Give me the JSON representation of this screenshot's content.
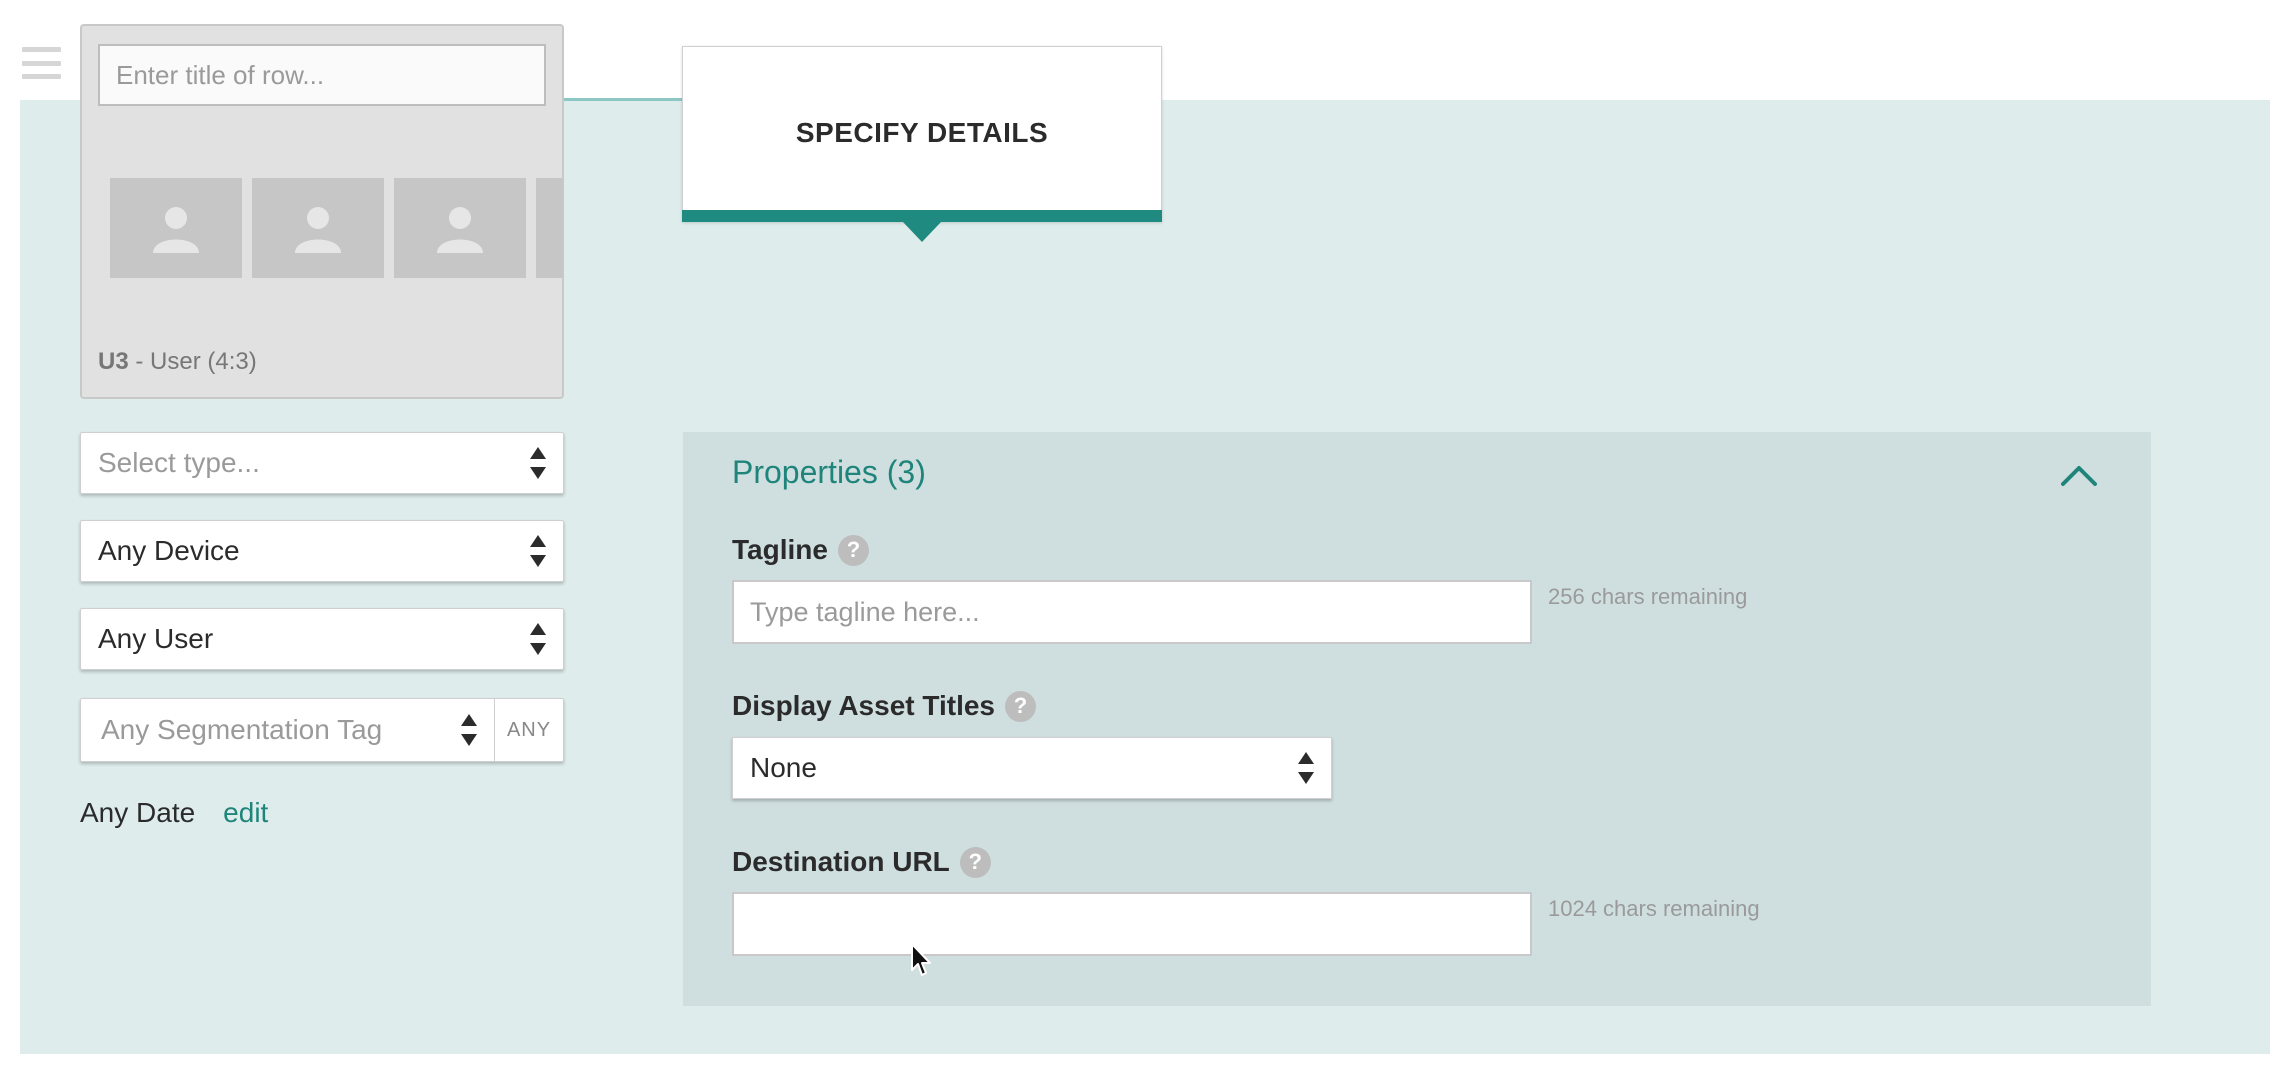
{
  "row_card": {
    "title_placeholder": "Enter title of row...",
    "thumbnail_icons": [
      "user-icon",
      "user-icon",
      "user-icon"
    ],
    "code": "U3",
    "meta_suffix": " - User (4:3)"
  },
  "filters": {
    "type_placeholder": "Select type...",
    "device_value": "Any Device",
    "user_value": "Any User",
    "segmentation_placeholder": "Any Segmentation Tag",
    "segmentation_mode": "ANY",
    "date_label": "Any Date",
    "date_edit": "edit"
  },
  "step": {
    "title": "SPECIFY DETAILS"
  },
  "properties": {
    "title": "Properties (3)",
    "collapse_icon": "chevron-up-icon",
    "help_glyph": "?",
    "tagline": {
      "label": "Tagline",
      "placeholder": "Type tagline here...",
      "remaining": "256 chars remaining"
    },
    "display_asset_titles": {
      "label": "Display Asset Titles",
      "value": "None"
    },
    "destination_url": {
      "label": "Destination URL",
      "value": "",
      "remaining": "1024 chars remaining"
    }
  },
  "colors": {
    "accent": "#1f857b",
    "band": "#deecec",
    "panel": "#cfdfe0"
  }
}
